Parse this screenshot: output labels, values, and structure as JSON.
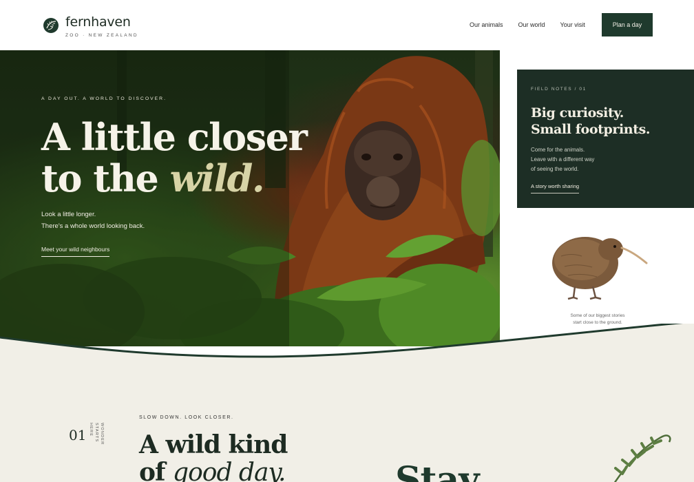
{
  "brand": {
    "name": "fernhaven",
    "subtitle": "ZOO · NEW ZEALAND"
  },
  "nav": {
    "items": [
      "Our animals",
      "Our world",
      "Your visit"
    ],
    "cta": "Plan a day"
  },
  "hero": {
    "eyebrow": "A DAY OUT. A WORLD TO DISCOVER.",
    "title_line1": "A little closer",
    "title_line2_plain": "to the",
    "title_line2_accent": "wild.",
    "body_line1": "Look a little longer.",
    "body_line2": "There's a whole world looking back.",
    "link": "Meet your wild neighbours"
  },
  "field_notes": {
    "eyebrow": "FIELD NOTES / 01",
    "title_line1": "Big curiosity.",
    "title_line2": "Small footprints.",
    "body_line1": "Come for the animals.",
    "body_line2": "Leave with a different way",
    "body_line3": "of seeing the world.",
    "link": "A story worth sharing"
  },
  "kiwi": {
    "caption_line1": "Some of our biggest stories",
    "caption_line2": "start close to the ground."
  },
  "section": {
    "number": "01",
    "vertical_label": "WONDER STARTS HERE",
    "eyebrow": "SLOW DOWN. LOOK CLOSER.",
    "title_line1": "A wild kind",
    "title_line2_plain": "of",
    "title_line2_accent": "good day.",
    "big_word": "Stay"
  },
  "colors": {
    "brand_green": "#1f3a2d",
    "card_green": "#1d2e25",
    "cream": "#f1efe7",
    "accent_sage": "#d7d3a6"
  }
}
